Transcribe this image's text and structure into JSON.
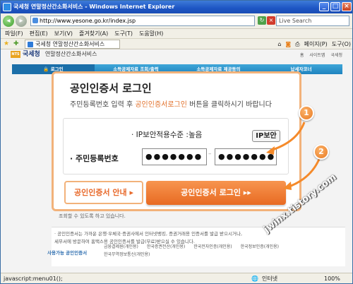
{
  "window": {
    "title": "국세청 연말정산간소화서비스 - Windows Internet Explorer",
    "controls": {
      "minimize": "_",
      "maximize": "□",
      "close": "×"
    }
  },
  "address": {
    "url": "http://www.yesone.go.kr/index.jsp",
    "search_placeholder": "Live Search"
  },
  "menu": [
    "파일(F)",
    "편집(E)",
    "보기(V)",
    "즐겨찾기(A)",
    "도구(T)",
    "도움말(H)"
  ],
  "tab": {
    "label": "국세청 연말정산간소화서비스"
  },
  "toolbar_right": [
    "페이지(P)",
    "도구(O)"
  ],
  "site": {
    "logo": "국세청",
    "subtitle": "연말정산간소화서비스",
    "toplinks": [
      "홈",
      "사이트맵",
      "국세청"
    ]
  },
  "nav": [
    "로그인",
    "소득공제자료 조회/출력",
    "소득공제자료 제공동의",
    "납세자코너"
  ],
  "login": {
    "title": "공인인증서 로그인",
    "desc_prefix": "주민등록번호 입력 후 ",
    "desc_highlight": "공인인증서로그인",
    "desc_suffix": " 버튼을 클릭하시기 바랍니다",
    "ip_label": "· IP보안적용수준 :높음",
    "ip_button": "IP보안",
    "rrn_label": "· 주민등록번호",
    "rrn_front": "●●●●●●●",
    "rrn_back": "●●●●●●●",
    "rrn_separator": "–",
    "guide_button": "공인인증서 안내 ▸",
    "login_button": "공인인증서 로그인   ▸▸",
    "badge1": "1",
    "badge2": "2"
  },
  "notes": {
    "below": "조회할 수 있도록 하고 있습니다.",
    "line1": "· 공인인증서는 가까운 은행·우체국·증권사에서 인터넷뱅킹, 증권거래용 인증서를 발급 받으시거나,",
    "line2": "  세무서에 방문하여 홈택스용 공인인증서를 발급(무료)받으실 수 있습니다.",
    "usable_title": "사용가능 공인인증서",
    "certs": [
      "금융결제원(개인용)",
      "한국증권전산(개인용)",
      "한국전자인증(개인용)",
      "한국정보인증(개인용)",
      "한국무역정보통신(개인용)"
    ]
  },
  "status": {
    "left": "javascript:menu01();",
    "zone": "인터넷",
    "zoom": "100%"
  },
  "watermark": "jwinx.tistory.com"
}
